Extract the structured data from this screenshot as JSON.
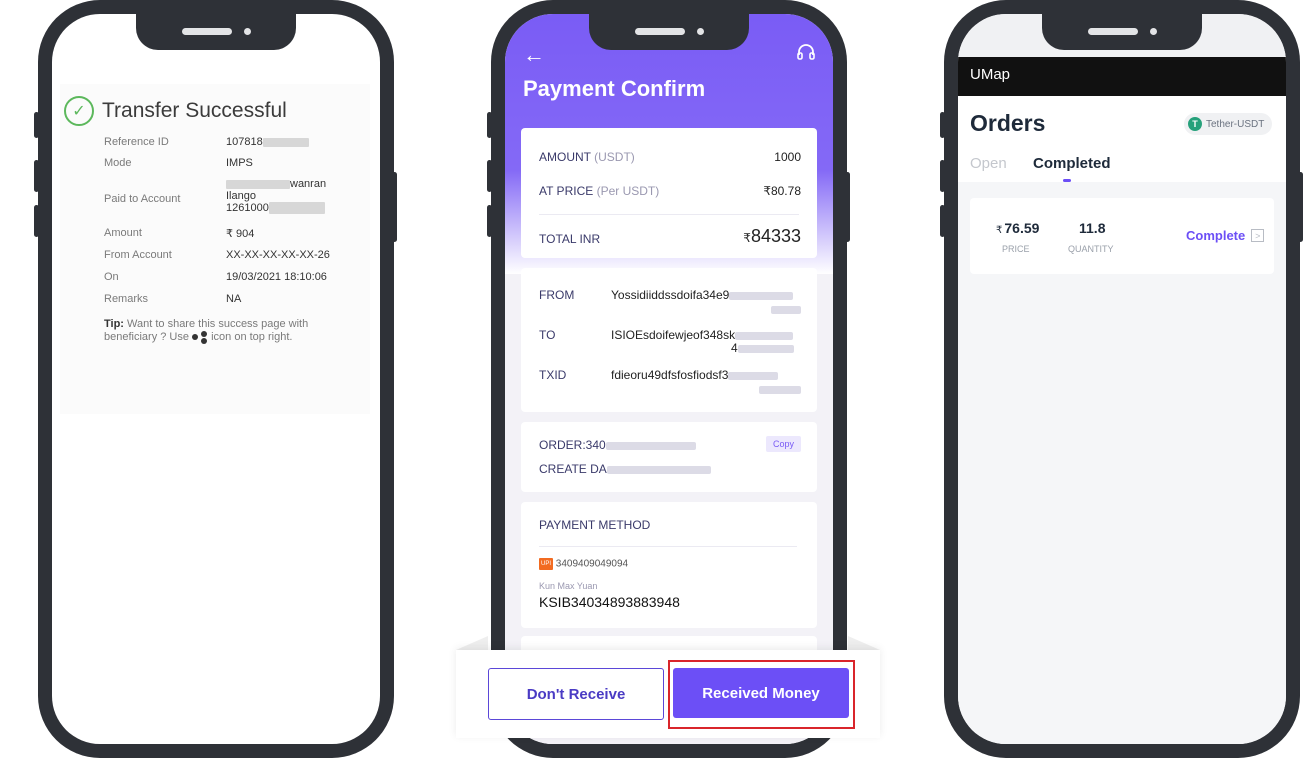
{
  "phone1": {
    "title": "Transfer Successful",
    "rows": [
      {
        "label": "Reference ID",
        "value": "107818"
      },
      {
        "label": "Mode",
        "value": "IMPS"
      },
      {
        "label": "Paid to Account",
        "value_line1": "wanran",
        "value_line2": "Ilango",
        "value_line3": "1261000"
      },
      {
        "label": "Amount",
        "value": "₹ 904"
      },
      {
        "label": "From Account",
        "value": "XX-XX-XX-XX-XX-26"
      },
      {
        "label": "On",
        "value": "19/03/2021 18:10:06"
      },
      {
        "label": "Remarks",
        "value": "NA"
      }
    ],
    "tip_bold": "Tip:",
    "tip_text": " Want to share this success page with beneficiary ? Use ",
    "tip_end": " icon on top right."
  },
  "phone2": {
    "title": "Payment Confirm",
    "amount_label": "AMOUNT",
    "amount_unit": " (USDT)",
    "amount_value": "1000",
    "price_label": "AT PRICE",
    "price_unit": " (Per USDT)",
    "price_value": "₹80.78",
    "total_label": "TOTAL INR",
    "total_currency": "₹",
    "total_value": "84333",
    "from_label": "FROM",
    "from_value": "Yossidiiddssdoifa34e9",
    "to_label": "TO",
    "to_value": "ISIOEsdoifewjeof348sk",
    "to_value2": "4",
    "txid_label": "TXID",
    "txid_value": "fdieoru49dfsfosfiodsf3",
    "order_label": "ORDER:340",
    "create_label": "CREATE DA",
    "copy_label": "Copy",
    "payment_method_label": "PAYMENT METHOD",
    "upi_badge": "UPI",
    "upi_number": "3409409049094",
    "account_name": "Kun Max Yuan",
    "account_number": "KSIB34034893883948",
    "dont_receive": "Don't Receive",
    "received_money": "Received Money"
  },
  "phone3": {
    "app_name": "UMap",
    "title": "Orders",
    "badge": "Tether-USDT",
    "tether_symbol": "T",
    "tab_open": "Open",
    "tab_completed": "Completed",
    "order": {
      "currency": "₹",
      "price": "76.59",
      "price_label": "PRICE",
      "quantity": "11.8",
      "quantity_label": "QUANTITY",
      "status": "Complete",
      "arrow": ">"
    }
  },
  "colors": {
    "accent": "#6c4ff6",
    "success": "#5cb85c",
    "highlight": "#d9252b",
    "tether": "#26a17b"
  }
}
